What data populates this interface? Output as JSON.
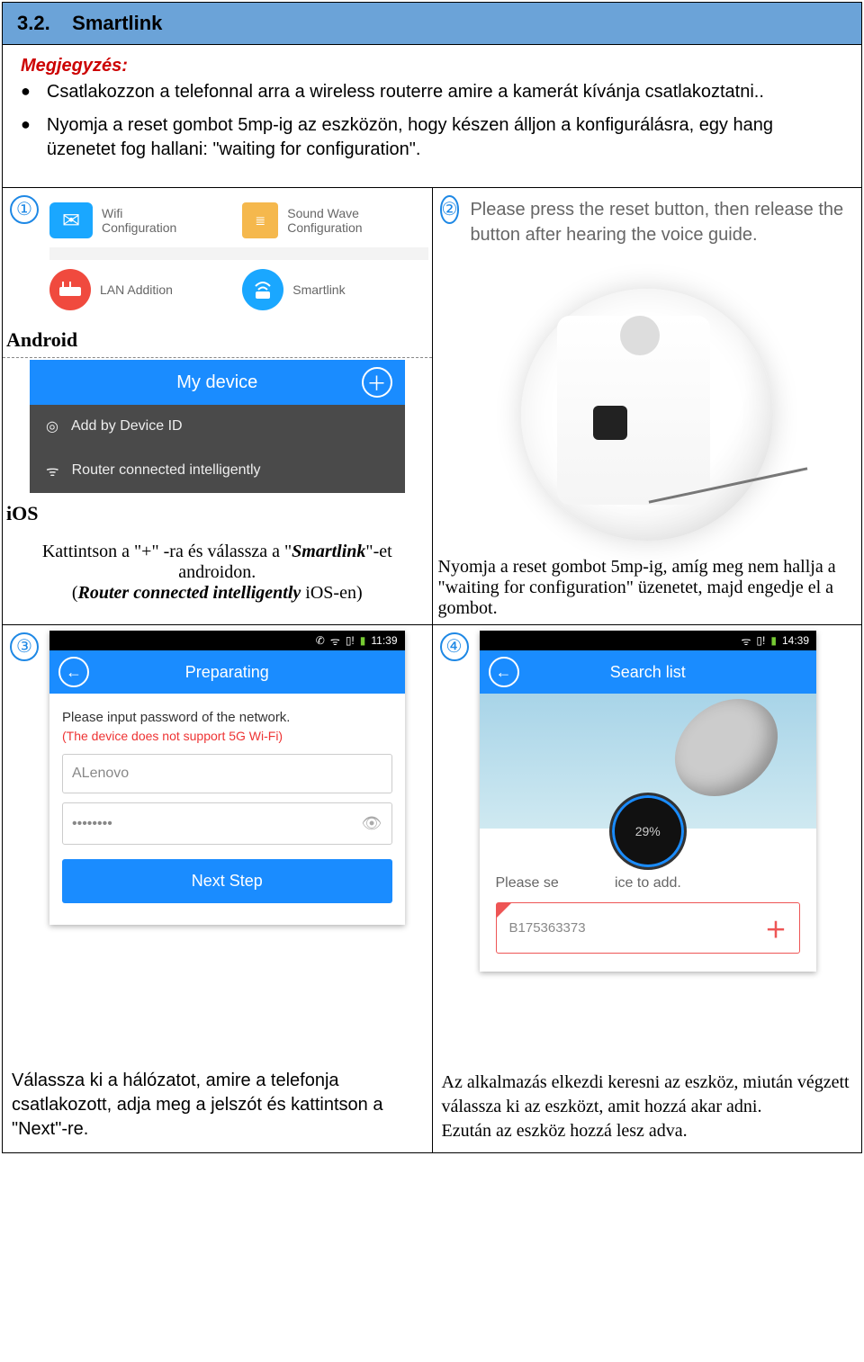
{
  "header": {
    "section_num": "3.2.",
    "title": "Smartlink"
  },
  "notes": {
    "title": "Megjegyzés:",
    "bullet1": "Csatlakozzon a telefonnal arra a wireless routerre amire a kamerát kívánja csatlakoztatni..",
    "bullet2": "Nyomja a reset gombot 5mp-ig az eszközön, hogy készen álljon a konfigurálásra, egy hang üzenetet fog hallani: \"waiting for configuration\"."
  },
  "step1": {
    "num": "①",
    "wifi_cfg_1": "Wifi",
    "wifi_cfg_2": "Configuration",
    "sound_cfg_1": "Sound Wave",
    "sound_cfg_2": "Configuration",
    "lan": "LAN Addition",
    "smartlink": "Smartlink",
    "android_label": "Android",
    "mydevice": "My device",
    "add_by_id": "Add by Device ID",
    "router_conn": "Router connected intelligently",
    "ios_label": "iOS",
    "caption_a": "Kattintson a \"+\" -ra és válassza a \"",
    "caption_b": "Smartlink",
    "caption_c": "\"-et androidon.",
    "caption_d": "(",
    "caption_e": "Router connected intelligently",
    "caption_f": " iOS-en)"
  },
  "step2": {
    "num": "②",
    "text": "Please press the reset button, then release the button after hearing the voice guide.",
    "caption_a": "Nyomja a reset gombot 5mp-ig, amíg meg nem hallja a \"",
    "caption_b": "waiting for configuration",
    "caption_c": "\" üzenetet, majd engedje el a gombot."
  },
  "step3": {
    "num": "③",
    "time": "11:39",
    "title": "Preparating",
    "instr": "Please input password of the network.",
    "warn": "(The device does not support 5G Wi-Fi)",
    "ssid": "ALenovo",
    "pwd": "••••••••",
    "btn": "Next Step",
    "caption": "Válassza ki a hálózatot, amire a telefonja csatlakozott, adja meg a jelszót és kattintson a \"Next\"-re."
  },
  "step4": {
    "num": "④",
    "time": "14:39",
    "title": "Search list",
    "progress": "29%",
    "please_a": "Please se",
    "please_b": "ice to add.",
    "device_id": "B175363373",
    "caption": "Az alkalmazás elkezdi keresni az eszköz, miután végzett válassza ki az eszközt, amit hozzá akar adni.\nEzután az eszköz hozzá lesz adva."
  }
}
